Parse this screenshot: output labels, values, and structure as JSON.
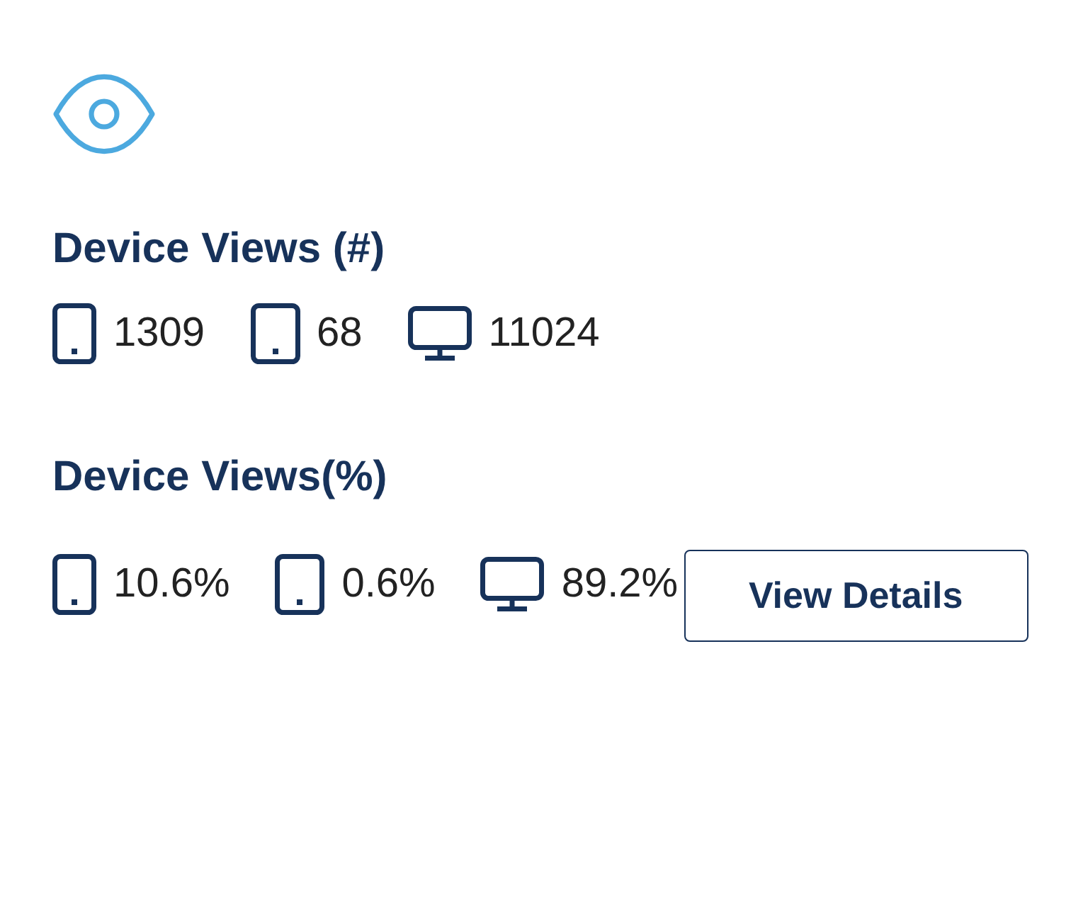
{
  "sections": [
    {
      "title": "Device Views (#)",
      "stats": [
        {
          "kind": "phone",
          "value": "1309"
        },
        {
          "kind": "tablet",
          "value": "68"
        },
        {
          "kind": "desktop",
          "value": "11024"
        }
      ]
    },
    {
      "title": "Device Views(%)",
      "stats": [
        {
          "kind": "phone",
          "value": "10.6%"
        },
        {
          "kind": "tablet",
          "value": "0.6%"
        },
        {
          "kind": "desktop",
          "value": "89.2%"
        }
      ],
      "button": {
        "label": "View Details"
      }
    }
  ]
}
